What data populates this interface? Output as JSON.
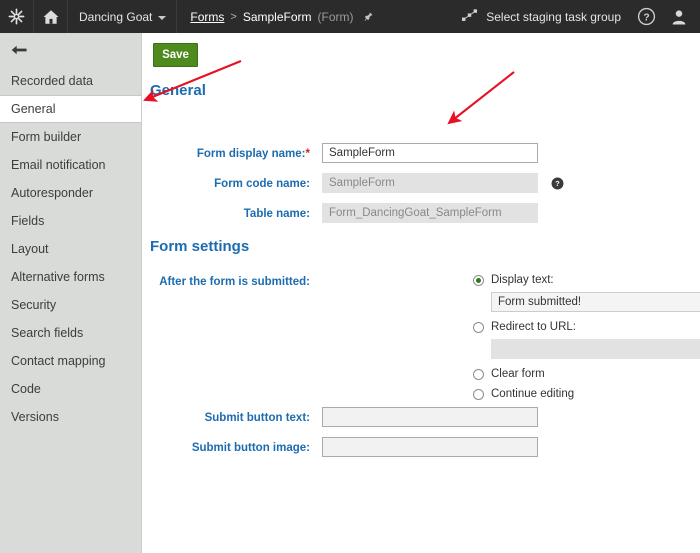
{
  "topbar": {
    "logo_icon": "kentico-asterisk-icon",
    "home_icon": "home-icon",
    "site_name": "Dancing Goat",
    "site_caret_icon": "caret-down-icon",
    "breadcrumb": {
      "root": "Forms",
      "separator": ">",
      "current": "SampleForm",
      "type": "(Form)",
      "pin_icon": "pin-icon"
    },
    "staging_icon": "staging-tasks-icon",
    "staging_label": "Select staging task group",
    "help_icon": "help-circle-icon",
    "user_icon": "user-avatar-icon",
    "background": "#2b2b2b"
  },
  "sidebar": {
    "back_icon": "back-arrow-icon",
    "background": "#d9dbd8",
    "active_index": 1,
    "items": [
      {
        "label": "Recorded data"
      },
      {
        "label": "General"
      },
      {
        "label": "Form builder"
      },
      {
        "label": "Email notification"
      },
      {
        "label": "Autoresponder"
      },
      {
        "label": "Fields"
      },
      {
        "label": "Layout"
      },
      {
        "label": "Alternative forms"
      },
      {
        "label": "Security"
      },
      {
        "label": "Search fields"
      },
      {
        "label": "Contact mapping"
      },
      {
        "label": "Code"
      },
      {
        "label": "Versions"
      }
    ]
  },
  "main": {
    "save_label": "Save",
    "save_color": "#4e8a1e",
    "heading_color": "#1d6cb0",
    "general": {
      "title": "General",
      "display_name_label": "Form display name:",
      "display_name_required": "*",
      "display_name_value": "SampleForm",
      "code_name_label": "Form code name:",
      "code_name_value": "SampleForm",
      "code_name_help_icon": "help-circle-icon",
      "table_name_label": "Table name:",
      "table_name_value": "Form_DancingGoat_SampleForm"
    },
    "form_settings": {
      "title": "Form settings",
      "after_submit_label": "After the form is submitted:",
      "options": [
        {
          "label": "Display text:",
          "selected": true
        },
        {
          "label": "Redirect to URL:",
          "selected": false
        },
        {
          "label": "Clear form",
          "selected": false
        },
        {
          "label": "Continue editing",
          "selected": false
        }
      ],
      "display_text_value": "Form submitted!",
      "redirect_url_value": "",
      "submit_button_text_label": "Submit button text:",
      "submit_button_text_value": "",
      "submit_button_image_label": "Submit button image:",
      "submit_button_image_value": ""
    }
  },
  "annotations": {
    "color": "#e81123",
    "arrow_1": "points-to-general-sidebar-item",
    "arrow_2": "points-to-form-display-name-input"
  }
}
